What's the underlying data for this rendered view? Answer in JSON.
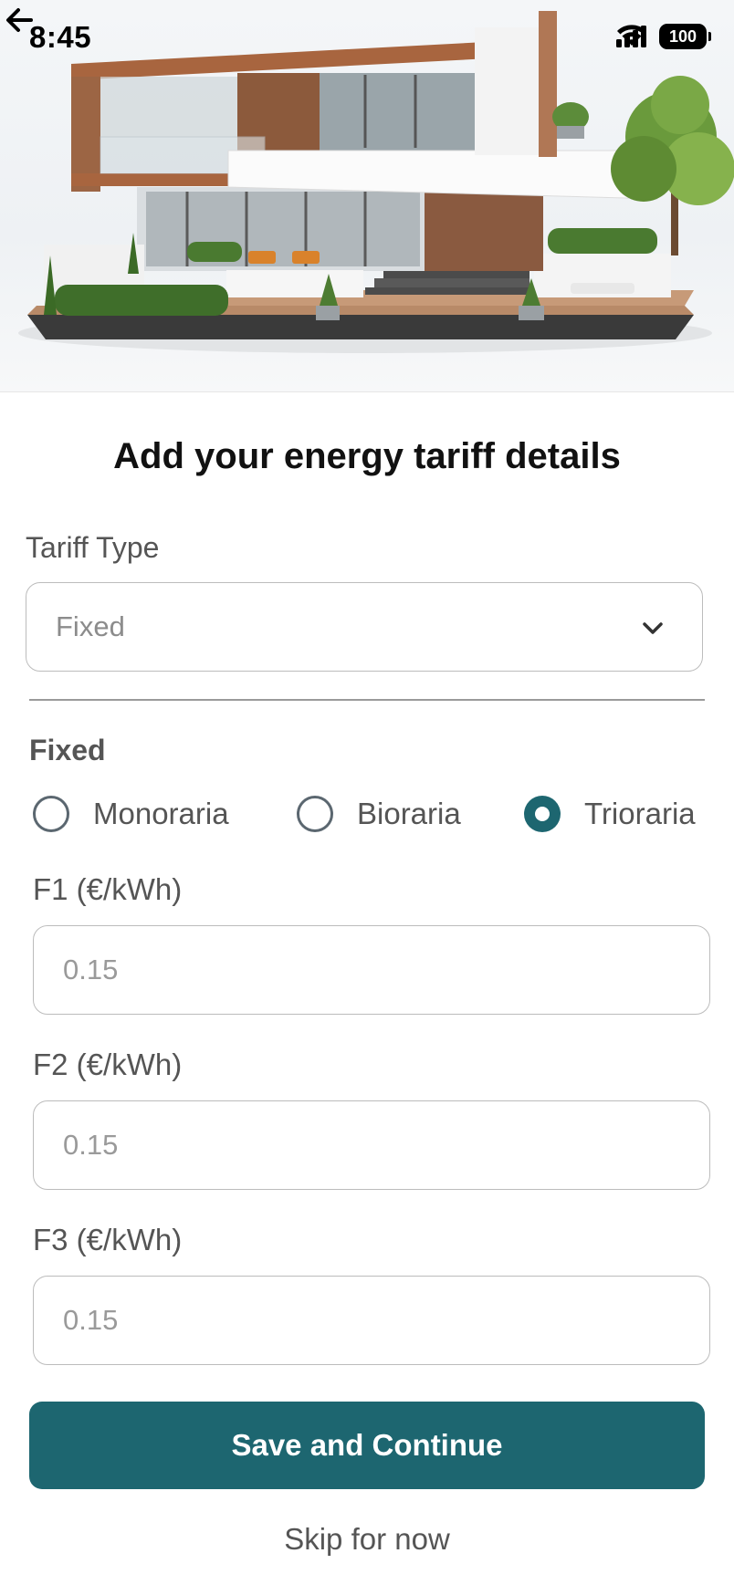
{
  "status_bar": {
    "time": "8:45",
    "battery": "100",
    "icons": [
      "signal-icon",
      "wifi-icon",
      "battery-icon"
    ]
  },
  "header": {
    "back_icon": "arrow-left-icon",
    "hero_image": "modern-house-illustration"
  },
  "page": {
    "title": "Add your energy tariff details"
  },
  "tariff_type": {
    "label": "Tariff Type",
    "value": "Fixed",
    "icon": "chevron-down-icon"
  },
  "section": {
    "title": "Fixed",
    "options": [
      {
        "label": "Monoraria",
        "selected": false
      },
      {
        "label": "Bioraria",
        "selected": false
      },
      {
        "label": "Trioraria",
        "selected": true
      }
    ]
  },
  "fields": [
    {
      "label": "F1 (€/kWh)",
      "placeholder": "0.15",
      "value": ""
    },
    {
      "label": "F2 (€/kWh)",
      "placeholder": "0.15",
      "value": ""
    },
    {
      "label": "F3 (€/kWh)",
      "placeholder": "0.15",
      "value": ""
    }
  ],
  "actions": {
    "primary": "Save and Continue",
    "secondary": "Skip for now"
  },
  "colors": {
    "accent": "#1d6670",
    "text_muted": "#555555",
    "border": "#bcbcbc"
  }
}
